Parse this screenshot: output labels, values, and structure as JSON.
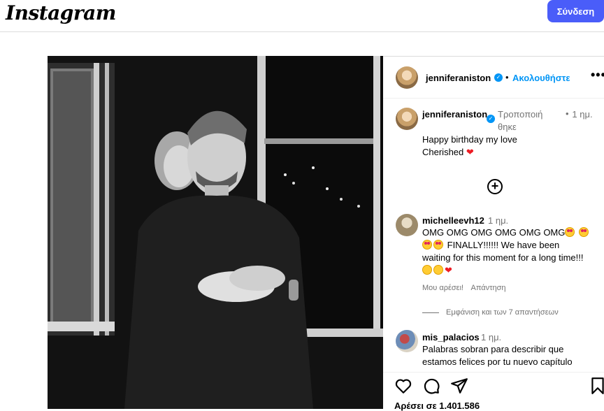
{
  "header": {
    "logo_text": "Instagram",
    "login_label": "Σύνδεση"
  },
  "post": {
    "author": "jenniferaniston",
    "follow_label": "Ακολουθήστε",
    "caption": {
      "username_line1": "jenniferaniston",
      "edited_label": "Τροποποιήθηκε",
      "time": "1 ημ.",
      "text_line1": "Happy birthday my love",
      "text_line2": "Cherished"
    },
    "comments": [
      {
        "username": "michelleevh12",
        "time": "1 ημ.",
        "text_prefix": "OMG OMG OMG OMG OMG OMG",
        "text_mid": "FINALLY!!!!!! We have been waiting for this moment for a long time!!!",
        "like_label": "Μου αρέσει!",
        "reply_label": "Απάντηση",
        "view_replies": "Εμφάνιση και των 7 απαντήσεων"
      },
      {
        "username": "mis_palacios",
        "time": "1 ημ.",
        "text": "Palabras sobran para describir que estamos felices por tu nuevo capítulo"
      }
    ],
    "likes_label": "Αρέσει σε 1.401.586"
  },
  "icons": {
    "heart": "heart-icon",
    "comment": "comment-icon",
    "share": "share-icon",
    "save": "bookmark-icon",
    "add_comment": "plus-circle-icon",
    "more": "more-icon",
    "verified": "verified-badge-icon"
  },
  "colors": {
    "accent": "#0095f6",
    "login_button": "#4a5df9",
    "heart": "#ed1c24"
  }
}
